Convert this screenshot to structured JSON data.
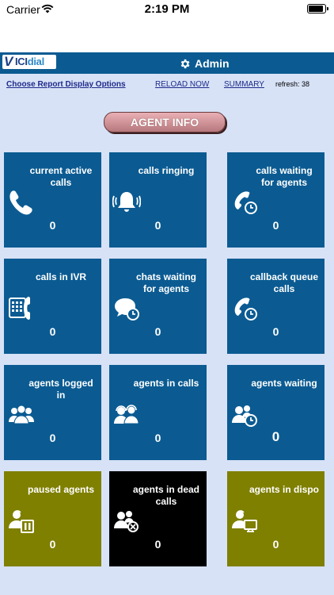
{
  "status_bar": {
    "carrier": "Carrier",
    "time": "2:19 PM"
  },
  "header": {
    "logo_v": "V",
    "logo_main": "ICI",
    "logo_accent": "dial",
    "admin_label": "Admin"
  },
  "toolbar": {
    "choose": "Choose Report Display Options",
    "reload": "RELOAD NOW",
    "summary": "SUMMARY",
    "refresh": "refresh: 38"
  },
  "agent_info_label": "AGENT INFO",
  "tiles": [
    {
      "label": "current active calls",
      "count": "0",
      "icon": "phone-icon",
      "color": "#0b5b92"
    },
    {
      "label": "calls ringing",
      "count": "0",
      "icon": "ringing-bell-icon",
      "color": "#0b5b92"
    },
    {
      "label": "calls waiting for agents",
      "count": "0",
      "icon": "phone-clock-icon",
      "color": "#0b5b92"
    },
    {
      "label": "calls in IVR",
      "count": "0",
      "icon": "ivr-keypad-icon",
      "color": "#0b5b92"
    },
    {
      "label": "chats waiting for agents",
      "count": "0",
      "icon": "chat-clock-icon",
      "color": "#0b5b92"
    },
    {
      "label": "callback queue calls",
      "count": "0",
      "icon": "phone-clock-icon",
      "color": "#0b5b92"
    },
    {
      "label": "agents logged in",
      "count": "0",
      "icon": "user-group-icon",
      "color": "#0b5b92"
    },
    {
      "label": "agents in calls",
      "count": "0",
      "icon": "headset-agents-icon",
      "color": "#0b5b92"
    },
    {
      "label": "agents waiting",
      "count": "0",
      "icon": "agents-clock-icon",
      "color": "#0b5b92"
    },
    {
      "label": "paused agents",
      "count": "0",
      "icon": "agent-pause-icon",
      "color": "#7f7f00"
    },
    {
      "label": "agents in dead calls",
      "count": "0",
      "icon": "agents-dead-call-icon",
      "color": "#000000"
    },
    {
      "label": "agents in dispo",
      "count": "0",
      "icon": "agent-dispo-icon",
      "color": "#7f7f00"
    }
  ]
}
